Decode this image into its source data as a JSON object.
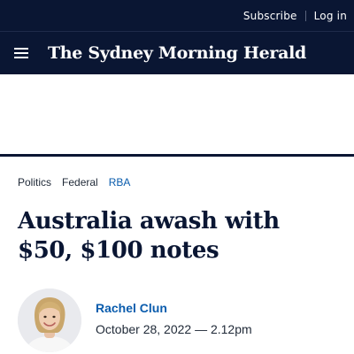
{
  "topbar": {
    "subscribe_label": "Subscribe",
    "login_label": "Log in"
  },
  "header": {
    "menu_icon": "hamburger-menu-icon",
    "masthead": "The Sydney Morning Herald"
  },
  "breadcrumbs": [
    {
      "label": "Politics",
      "active": false
    },
    {
      "label": "Federal",
      "active": false
    },
    {
      "label": "RBA",
      "active": true
    }
  ],
  "article": {
    "headline": "Australia awash with $50, $100 notes",
    "author": "Rachel Clun",
    "date": "October 28, 2022 — 2.12pm"
  },
  "colors": {
    "navy": "#0a1633",
    "link_blue": "#0a5cad"
  }
}
